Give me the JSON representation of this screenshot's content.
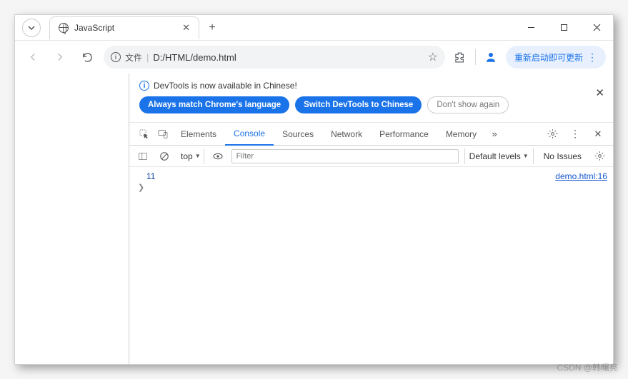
{
  "window": {
    "tab_title": "JavaScript"
  },
  "addr": {
    "file_label": "文件",
    "path": "D:/HTML/demo.html"
  },
  "update_btn": "重新启动即可更新",
  "banner": {
    "msg": "DevTools is now available in Chinese!",
    "btn1": "Always match Chrome's language",
    "btn2": "Switch DevTools to Chinese",
    "btn3": "Don't show again"
  },
  "tabs": {
    "elements": "Elements",
    "console": "Console",
    "sources": "Sources",
    "network": "Network",
    "performance": "Performance",
    "memory": "Memory"
  },
  "toolbar": {
    "context": "top",
    "filter_ph": "Filter",
    "levels": "Default levels",
    "issues": "No Issues"
  },
  "console": {
    "value": "11",
    "source": "demo.html:16"
  },
  "watermark": "CSDN @韩曙亮"
}
